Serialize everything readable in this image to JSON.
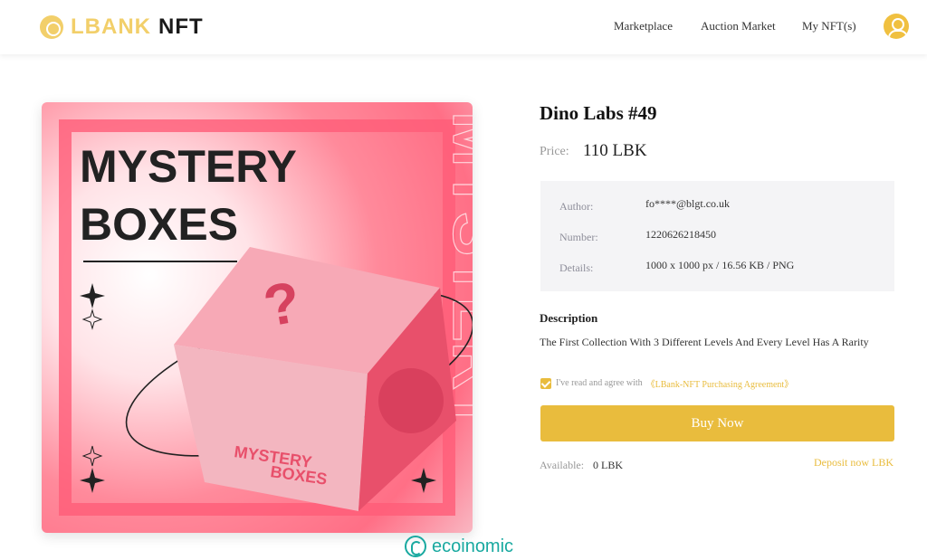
{
  "header": {
    "logo_text": "LBANK",
    "logo_suffix": "NFT",
    "nav": [
      "Marketplace",
      "Auction Market",
      "My NFT(s)"
    ]
  },
  "artwork": {
    "headline_line1": "MYSTERY",
    "headline_line2": "BOXES",
    "side_text": "MYSTERY",
    "cube_question": "?",
    "cube_text_line1": "MYSTERY",
    "cube_text_line2": "BOXES",
    "colors": {
      "pink": "#ff6f86",
      "deep_pink": "#e8506b",
      "light_pink": "#ffd6dc"
    }
  },
  "product": {
    "title": "Dino Labs #49",
    "price_label": "Price:",
    "price_value": "110 LBK"
  },
  "details": {
    "rows": [
      {
        "label": "Author:",
        "value": "fo****@blgt.co.uk"
      },
      {
        "label": "Number:",
        "value": "1220626218450"
      },
      {
        "label": "Details:",
        "value": "1000 x 1000 px / 16.56 KB / PNG"
      }
    ]
  },
  "description": {
    "heading": "Description",
    "text": "The First Collection With 3 Different Levels And Every Level Has A Rarity"
  },
  "agreement": {
    "checked": true,
    "text": "I've read and agree with",
    "link": "《LBank-NFT Purchasing Agreement》"
  },
  "actions": {
    "buy_label": "Buy Now",
    "available_label": "Available:",
    "available_value": "0 LBK",
    "deposit_label": "Deposit now LBK"
  },
  "watermark": {
    "text": "ecoinomic"
  },
  "colors": {
    "accent": "#e9bc3d",
    "logo": "#f2cf6a",
    "watermark": "#19a9a0"
  }
}
